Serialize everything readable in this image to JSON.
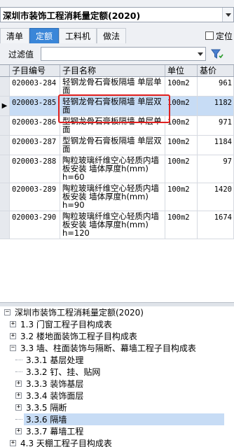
{
  "dictionary_select": {
    "value": "深圳市装饰工程消耗量定额(2020)"
  },
  "tabs": [
    {
      "label": "清单",
      "active": false
    },
    {
      "label": "定额",
      "active": true
    },
    {
      "label": "工料机",
      "active": false
    },
    {
      "label": "做法",
      "active": false
    }
  ],
  "locate_label": "定位",
  "filter": {
    "label": "过滤值",
    "value": ""
  },
  "grid": {
    "columns": [
      "子目编号",
      "子目名称",
      "单位",
      "基价"
    ],
    "rows": [
      {
        "code": "020003-284",
        "name": "轻钢龙骨石膏板隔墙 单层单面",
        "unit": "100m2",
        "price": "961"
      },
      {
        "code": "020003-285",
        "name": "轻钢龙骨石膏板隔墙 单层双面",
        "unit": "100m2",
        "price": "1182"
      },
      {
        "code": "020003-286",
        "name": "型钢龙骨石膏板隔墙 单层单面",
        "unit": "100m2",
        "price": "971"
      },
      {
        "code": "020003-287",
        "name": "型钢龙骨石膏板隔墙 单层双面",
        "unit": "100m2",
        "price": "1184"
      },
      {
        "code": "020003-288",
        "name": "陶粒玻璃纤维空心轻质内墙板安装 墙体厚度h(mm) h=60",
        "unit": "100m2",
        "price": "97"
      },
      {
        "code": "020003-289",
        "name": "陶粒玻璃纤维空心轻质内墙板安装 墙体厚度h(mm) h=90",
        "unit": "100m2",
        "price": "1420"
      },
      {
        "code": "020003-290",
        "name": "陶粒玻璃纤维空心轻质内墙板安装 墙体厚度h(mm) h=120",
        "unit": "100m2",
        "price": "1674"
      }
    ],
    "selected_index": 1
  },
  "tree": {
    "nodes": [
      {
        "label": "深圳市装饰工程消耗量定额(2020)",
        "box": "-",
        "level": 0
      },
      {
        "label": "1.3 门窗工程子目构成表",
        "box": "+",
        "level": 1
      },
      {
        "label": "3.2 楼地面装饰工程子目构成表",
        "box": "+",
        "level": 1
      },
      {
        "label": "3.3 墙、柱面装饰与隔断、幕墙工程子目构成表",
        "box": "-",
        "level": 1
      },
      {
        "label": "3.3.1 基层处理",
        "box": "",
        "level": 2
      },
      {
        "label": "3.3.2 钉、挂、贴网",
        "box": "",
        "level": 2
      },
      {
        "label": "3.3.3 装饰基层",
        "box": "+",
        "level": 2
      },
      {
        "label": "3.3.4 装饰面层",
        "box": "+",
        "level": 2
      },
      {
        "label": "3.3.5 隔断",
        "box": "+",
        "level": 2
      },
      {
        "label": "3.3.6 隔墙",
        "box": "",
        "level": 2,
        "selected": true
      },
      {
        "label": "3.3.7 幕墙工程",
        "box": "+",
        "level": 2
      },
      {
        "label": "4.3 天棚工程子目构成表",
        "box": "+",
        "level": 1
      }
    ]
  }
}
